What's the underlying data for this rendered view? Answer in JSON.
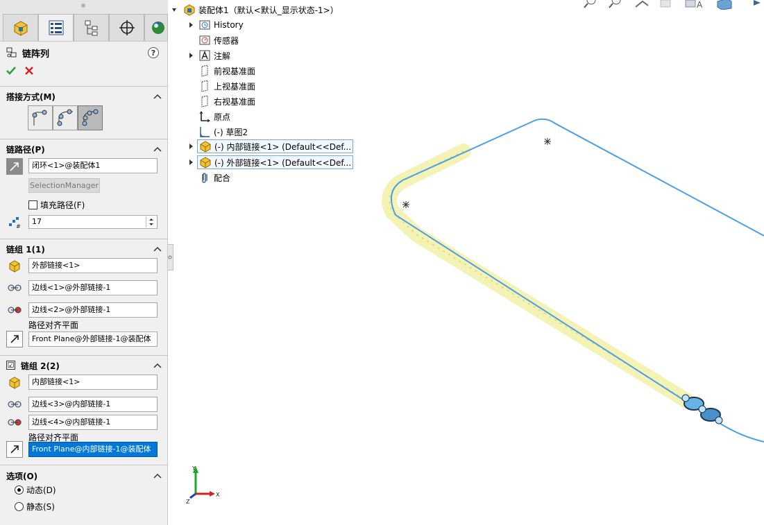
{
  "property_manager": {
    "title": "链阵列",
    "help": "?",
    "sections": {
      "connection": {
        "title": "搭接方式(M)"
      },
      "chain_path": {
        "title": "链路径(P)",
        "path_field": "闭环<1>@装配体1",
        "selection_manager": "SelectionManager",
        "fill_path_label": "填充路径(F)",
        "count_value": "17"
      },
      "chain_group_1": {
        "title": "链组 1(1)",
        "part_field": "外部链接<1>",
        "edge1_field": "边线<1>@外部链接-1",
        "edge2_field": "边线<2>@外部链接-1",
        "plane_label": "路径对齐平面",
        "plane_field": "Front Plane@外部链接-1@装配体"
      },
      "chain_group_2": {
        "title": "链组 2(2)",
        "checked": "☑",
        "part_field": "内部链接<1>",
        "edge1_field": "边线<3>@内部链接-1",
        "edge2_field": "边线<4>@内部链接-1",
        "plane_label": "路径对齐平面",
        "plane_field": "Front Plane@内部链接-1@装配体"
      },
      "options": {
        "title": "选项(O)",
        "dynamic_label": "动态(D)",
        "static_label": "静态(S)",
        "selected": "动态"
      }
    }
  },
  "feature_tree": {
    "root": "装配体1（默认<默认_显示状态-1>）",
    "items": [
      "History",
      "传感器",
      "注解",
      "前视基准面",
      "上视基准面",
      "右视基准面",
      "原点",
      "(-) 草图2",
      "(-) 内部链接<1> (Default<<Def...",
      "(-) 外部链接<1> (Default<<Def...",
      "配合"
    ]
  },
  "axes": {
    "x": "X",
    "y": "Y",
    "z": "Z"
  },
  "colors": {
    "path_line": "#4a9fe8",
    "chain_glow": "#f2f0a8",
    "selection_blue": "#0078d7"
  }
}
